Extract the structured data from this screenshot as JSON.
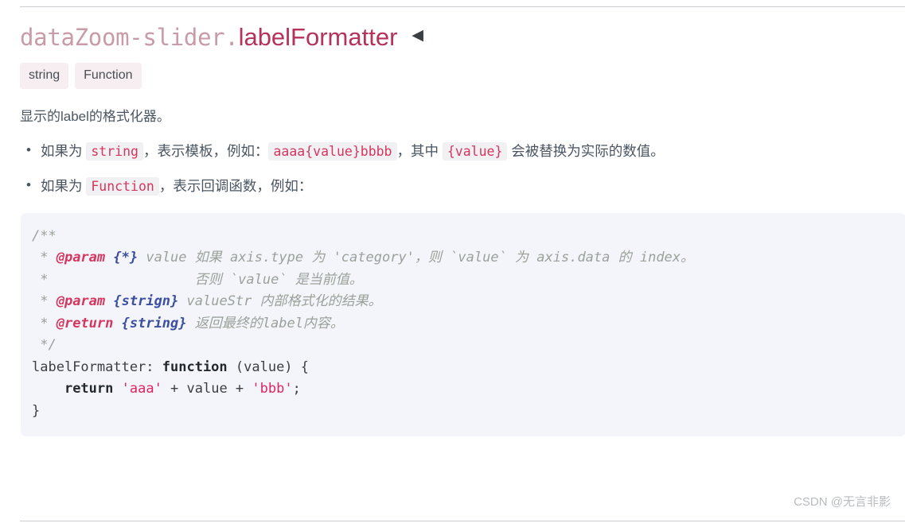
{
  "doc": {
    "title": {
      "prefix": "dataZoom-slider.",
      "property": "labelFormatter",
      "collapse_icon": "◀"
    },
    "type_badges": [
      "string",
      "Function"
    ],
    "description": "显示的label的格式化器。",
    "bullets": [
      {
        "segments": [
          {
            "kind": "text",
            "value": "如果为 "
          },
          {
            "kind": "code",
            "value": "string"
          },
          {
            "kind": "text",
            "value": "，表示模板，例如："
          },
          {
            "kind": "code",
            "value": "aaaa{value}bbbb"
          },
          {
            "kind": "text",
            "value": "，其中 "
          },
          {
            "kind": "code",
            "value": "{value}"
          },
          {
            "kind": "text",
            "value": " 会被替换为实际的数值。"
          }
        ],
        "b0_t0": "如果为 ",
        "b0_c1": "string",
        "b0_t2": "，表示模板，例如：",
        "b0_c3": "aaaa{value}bbbb",
        "b0_t4": "，其中 ",
        "b0_c5": "{value}",
        "b0_t6": " 会被替换为实际的数值。"
      },
      {
        "b1_t0": "如果为 ",
        "b1_c1": "Function",
        "b1_t2": "，表示回调函数，例如："
      }
    ],
    "code": {
      "language": "javascript",
      "lines": [
        "/**",
        " * @param {*} value 如果 axis.type 为 'category'，则 `value` 为 axis.data 的 index。",
        " *                  否则 `value` 是当前值。",
        " * @param {strign} valueStr 内部格式化的结果。",
        " * @return {string} 返回最终的label内容。",
        " */",
        "labelFormatter: function (value) {",
        "    return 'aaa' + value + 'bbb';",
        "}"
      ],
      "tokens": {
        "l0": "/**",
        "l1_a": " * ",
        "l1_tag": "@param",
        "l1_b": " ",
        "l1_type": "{*}",
        "l1_c": " value 如果 axis.type 为 'category'，则 `value` 为 axis.data 的 index。",
        "l2": " *                  否则 `value` 是当前值。",
        "l3_a": " * ",
        "l3_tag": "@param",
        "l3_b": " ",
        "l3_type": "{strign}",
        "l3_c": " valueStr 内部格式化的结果。",
        "l4_a": " * ",
        "l4_tag": "@return",
        "l4_b": " ",
        "l4_type": "{string}",
        "l4_c": " 返回最终的label内容。",
        "l5": " */",
        "l6_a": "labelFormatter: ",
        "l6_kw": "function",
        "l6_b": " (value) {",
        "l7_a": "    ",
        "l7_kw": "return",
        "l7_b": " ",
        "l7_s1": "'aaa'",
        "l7_c": " + value + ",
        "l7_s2": "'bbb'",
        "l7_d": ";",
        "l8": "}"
      }
    },
    "watermark": "CSDN @无言非影",
    "colors": {
      "accent": "#b4325b",
      "code_string": "#e0245e",
      "code_comment": "#9aa19a",
      "code_type": "#3b4ea0",
      "code_bg": "#f4f5fa",
      "badge_bg": "#f6eef0",
      "body_text": "#4a5561"
    }
  }
}
